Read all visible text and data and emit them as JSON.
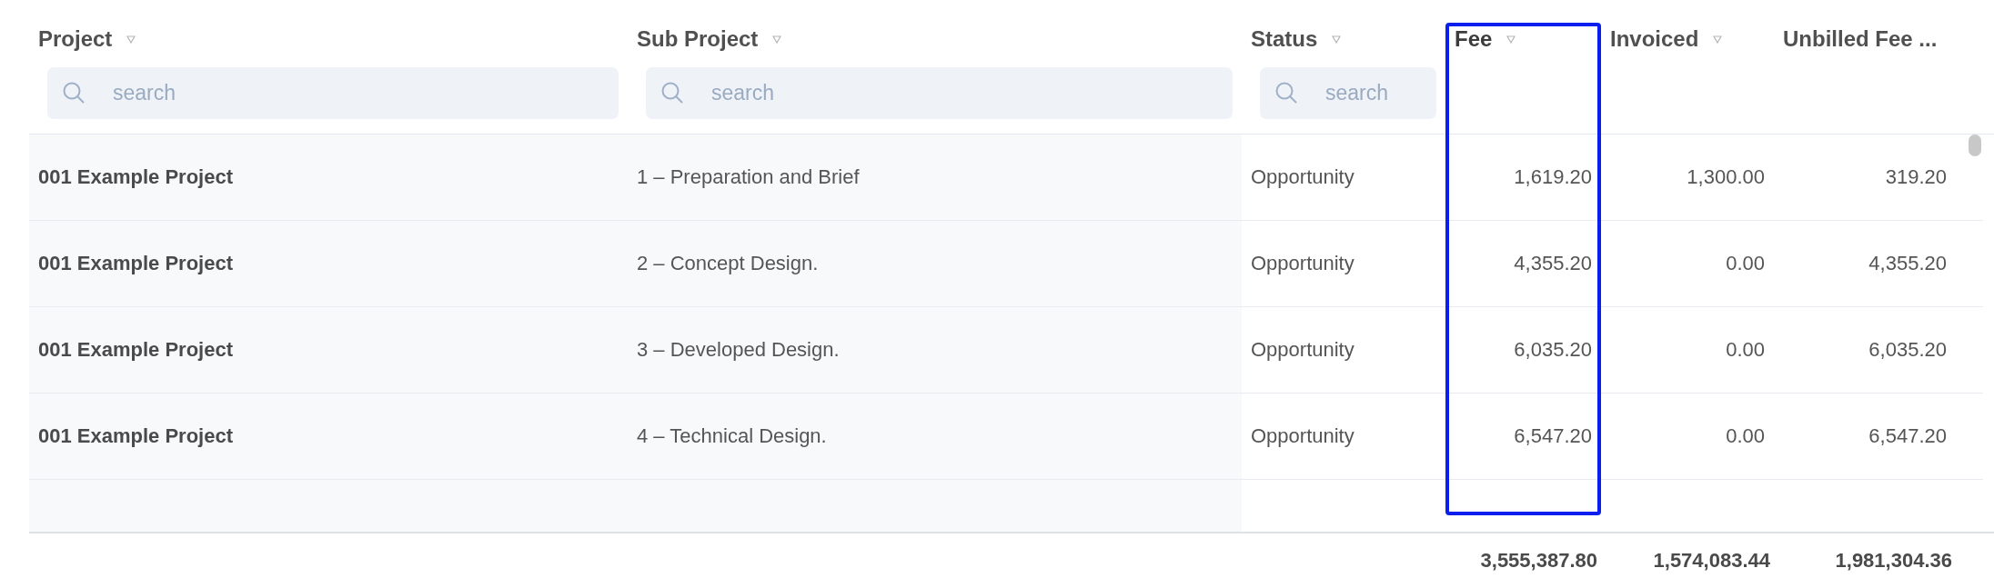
{
  "table": {
    "columns": [
      {
        "label": "Project",
        "kind": "text",
        "sortable": true,
        "filter": {
          "placeholder": "search"
        },
        "highlighted": false
      },
      {
        "label": "Sub Project",
        "kind": "text",
        "sortable": true,
        "filter": {
          "placeholder": "search"
        },
        "highlighted": false
      },
      {
        "label": "Status",
        "kind": "text",
        "sortable": true,
        "filter": {
          "placeholder": "search"
        },
        "highlighted": false
      },
      {
        "label": "Fee",
        "kind": "number",
        "sortable": true,
        "highlighted": true
      },
      {
        "label": "Invoiced",
        "kind": "number",
        "sortable": true,
        "highlighted": false
      },
      {
        "label": "Unbilled Fee ...",
        "kind": "number",
        "highlighted": false
      }
    ],
    "rows": [
      {
        "cells": [
          "001 Example Project",
          "1 – Preparation and Brief",
          "Opportunity",
          "1,619.20",
          "1,300.00",
          "319.20"
        ]
      },
      {
        "cells": [
          "001 Example Project",
          "2 – Concept Design.",
          "Opportunity",
          "4,355.20",
          "0.00",
          "4,355.20"
        ]
      },
      {
        "cells": [
          "001 Example Project",
          "3 – Developed Design.",
          "Opportunity",
          "6,035.20",
          "0.00",
          "6,035.20"
        ]
      },
      {
        "cells": [
          "001 Example Project",
          "4 – Technical Design.",
          "Opportunity",
          "6,547.20",
          "0.00",
          "6,547.20"
        ]
      }
    ],
    "totals": [
      "3,555,387.80",
      "1,574,083.44",
      "1,981,304.36"
    ]
  }
}
